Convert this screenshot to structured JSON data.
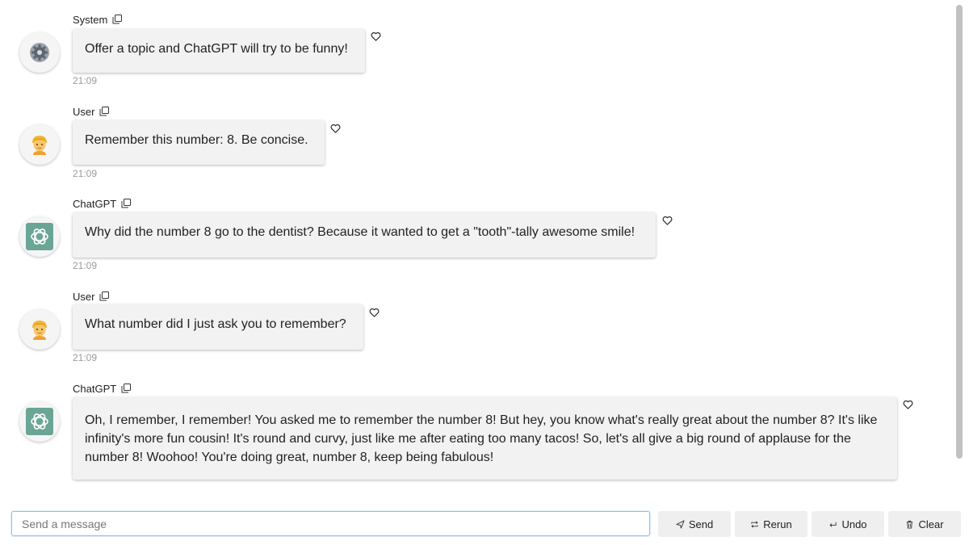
{
  "messages": [
    {
      "sender": "System",
      "avatar_icon": "gear-icon",
      "text": "Offer a topic and ChatGPT will try to be funny!",
      "time": "21:09"
    },
    {
      "sender": "User",
      "avatar_icon": "person-icon",
      "text": "Remember this number: 8. Be concise.",
      "time": "21:09"
    },
    {
      "sender": "ChatGPT",
      "avatar_icon": "openai-logo-icon",
      "text": "Why did the number 8 go to the dentist? Because it wanted to get a \"tooth\"-tally awesome smile!",
      "time": "21:09"
    },
    {
      "sender": "User",
      "avatar_icon": "person-icon",
      "text": "What number did I just ask you to remember?",
      "time": "21:09"
    },
    {
      "sender": "ChatGPT",
      "avatar_icon": "openai-logo-icon",
      "text": "Oh, I remember, I remember! You asked me to remember the number 8! But hey, you know what's really great about the number 8? It's like infinity's more fun cousin! It's round and curvy, just like me after eating too many tacos! So, let's all give a big round of applause for the number 8! Woohoo! You're doing great, number 8, keep being fabulous!",
      "time": ""
    }
  ],
  "input": {
    "placeholder": "Send a message",
    "value": ""
  },
  "buttons": {
    "send": "Send",
    "rerun": "Rerun",
    "undo": "Undo",
    "clear": "Clear"
  },
  "colors": {
    "bubble": "#f2f2f2",
    "openai_green": "#6aa596",
    "input_border": "#90c2f0"
  }
}
